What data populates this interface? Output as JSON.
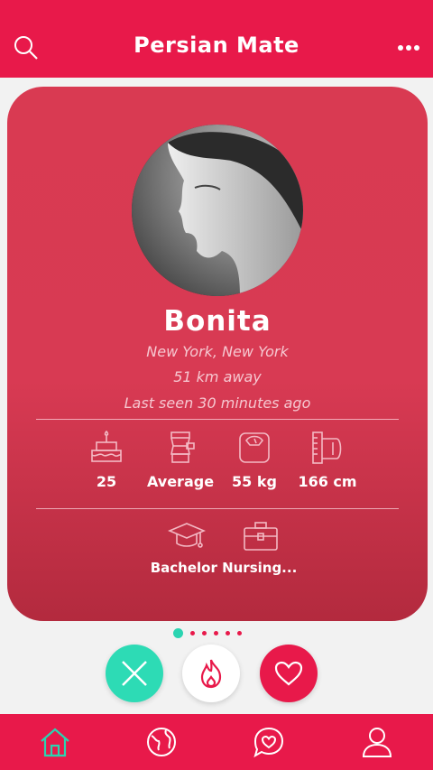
{
  "header": {
    "title": "Persian Mate"
  },
  "profile": {
    "name": "Bonita",
    "location": "New York, New York",
    "distance": "51 km away",
    "last_seen": "Last seen 30 minutes ago"
  },
  "stats": {
    "age": "25",
    "body": "Average",
    "weight": "55 kg",
    "height": "166 cm"
  },
  "details": {
    "education_work": "Bachelor Nursing..."
  },
  "pager": {
    "count": 6,
    "active": 0
  },
  "colors": {
    "brand": "#e8194a",
    "accent": "#2ddbb5",
    "card": "#d83a53"
  },
  "icons": {
    "header": [
      "search-icon",
      "more-icon"
    ],
    "actions": [
      "close-icon",
      "flame-icon",
      "heart-icon"
    ],
    "tabs": [
      "home-icon",
      "globe-icon",
      "chat-heart-icon",
      "profile-icon"
    ]
  }
}
